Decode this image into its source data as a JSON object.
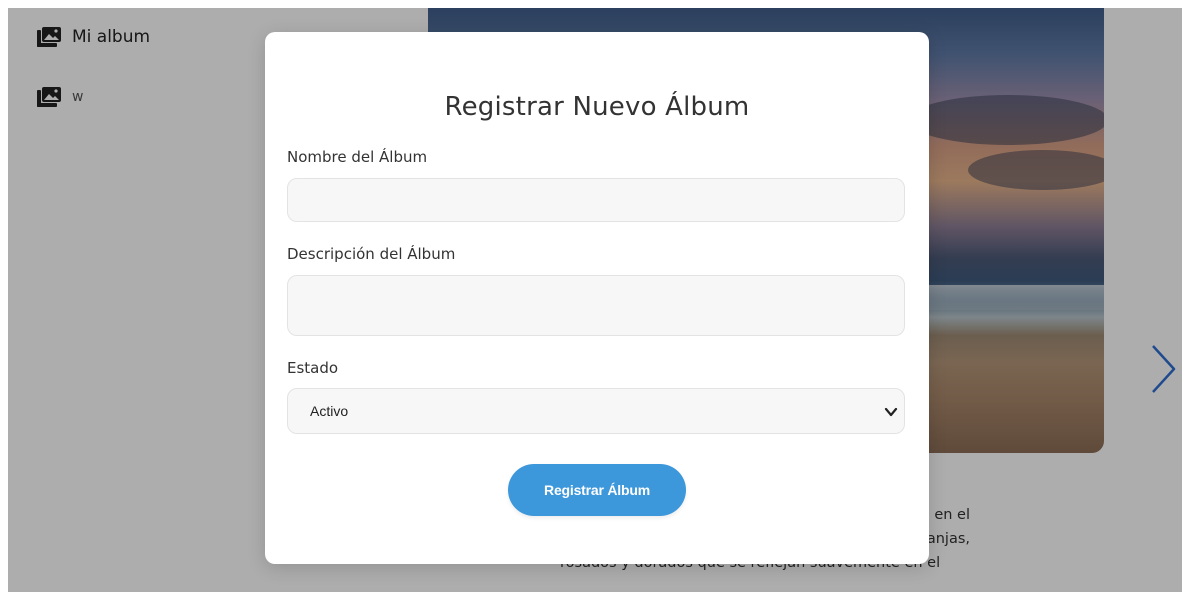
{
  "sidebar": {
    "items": [
      {
        "label": "Mi album",
        "icon": "photo-album-icon"
      },
      {
        "label": "w",
        "icon": "photo-album-icon"
      }
    ]
  },
  "article": {
    "line1": "en el",
    "line2": "anjas,",
    "line3": "rosados y dorados que se reflejan suavemente en el"
  },
  "modal": {
    "title": "Registrar Nuevo Álbum",
    "name_label": "Nombre del Álbum",
    "name_value": "",
    "description_label": "Descripción del Álbum",
    "description_value": "",
    "state_label": "Estado",
    "state_selected": "Activo",
    "submit_label": "Registrar Álbum"
  },
  "colors": {
    "accent": "#3d97db",
    "arrow": "#2f6fd1"
  }
}
